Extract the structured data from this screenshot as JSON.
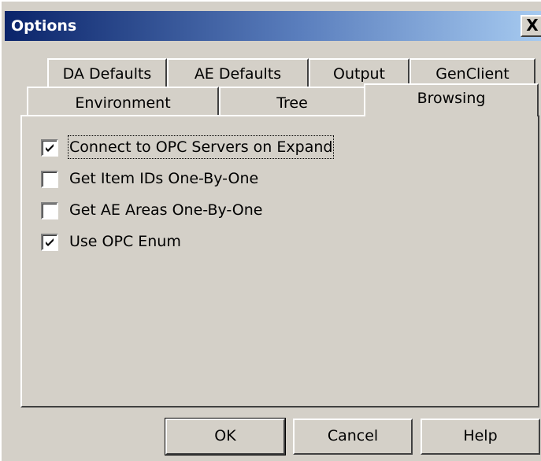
{
  "window": {
    "title": "Options",
    "close_label": "X"
  },
  "tabs_back": [
    "DA Defaults",
    "AE Defaults",
    "Output",
    "GenClient"
  ],
  "tabs_front": [
    "Environment",
    "Tree",
    "Browsing"
  ],
  "selected_tab": "Browsing",
  "options": [
    {
      "label": "Connect to OPC Servers on Expand",
      "checked": true
    },
    {
      "label": "Get Item IDs One-By-One",
      "checked": false
    },
    {
      "label": "Get AE Areas One-By-One",
      "checked": false
    },
    {
      "label": "Use OPC Enum",
      "checked": true
    }
  ],
  "buttons": {
    "ok": "OK",
    "cancel": "Cancel",
    "help": "Help"
  }
}
